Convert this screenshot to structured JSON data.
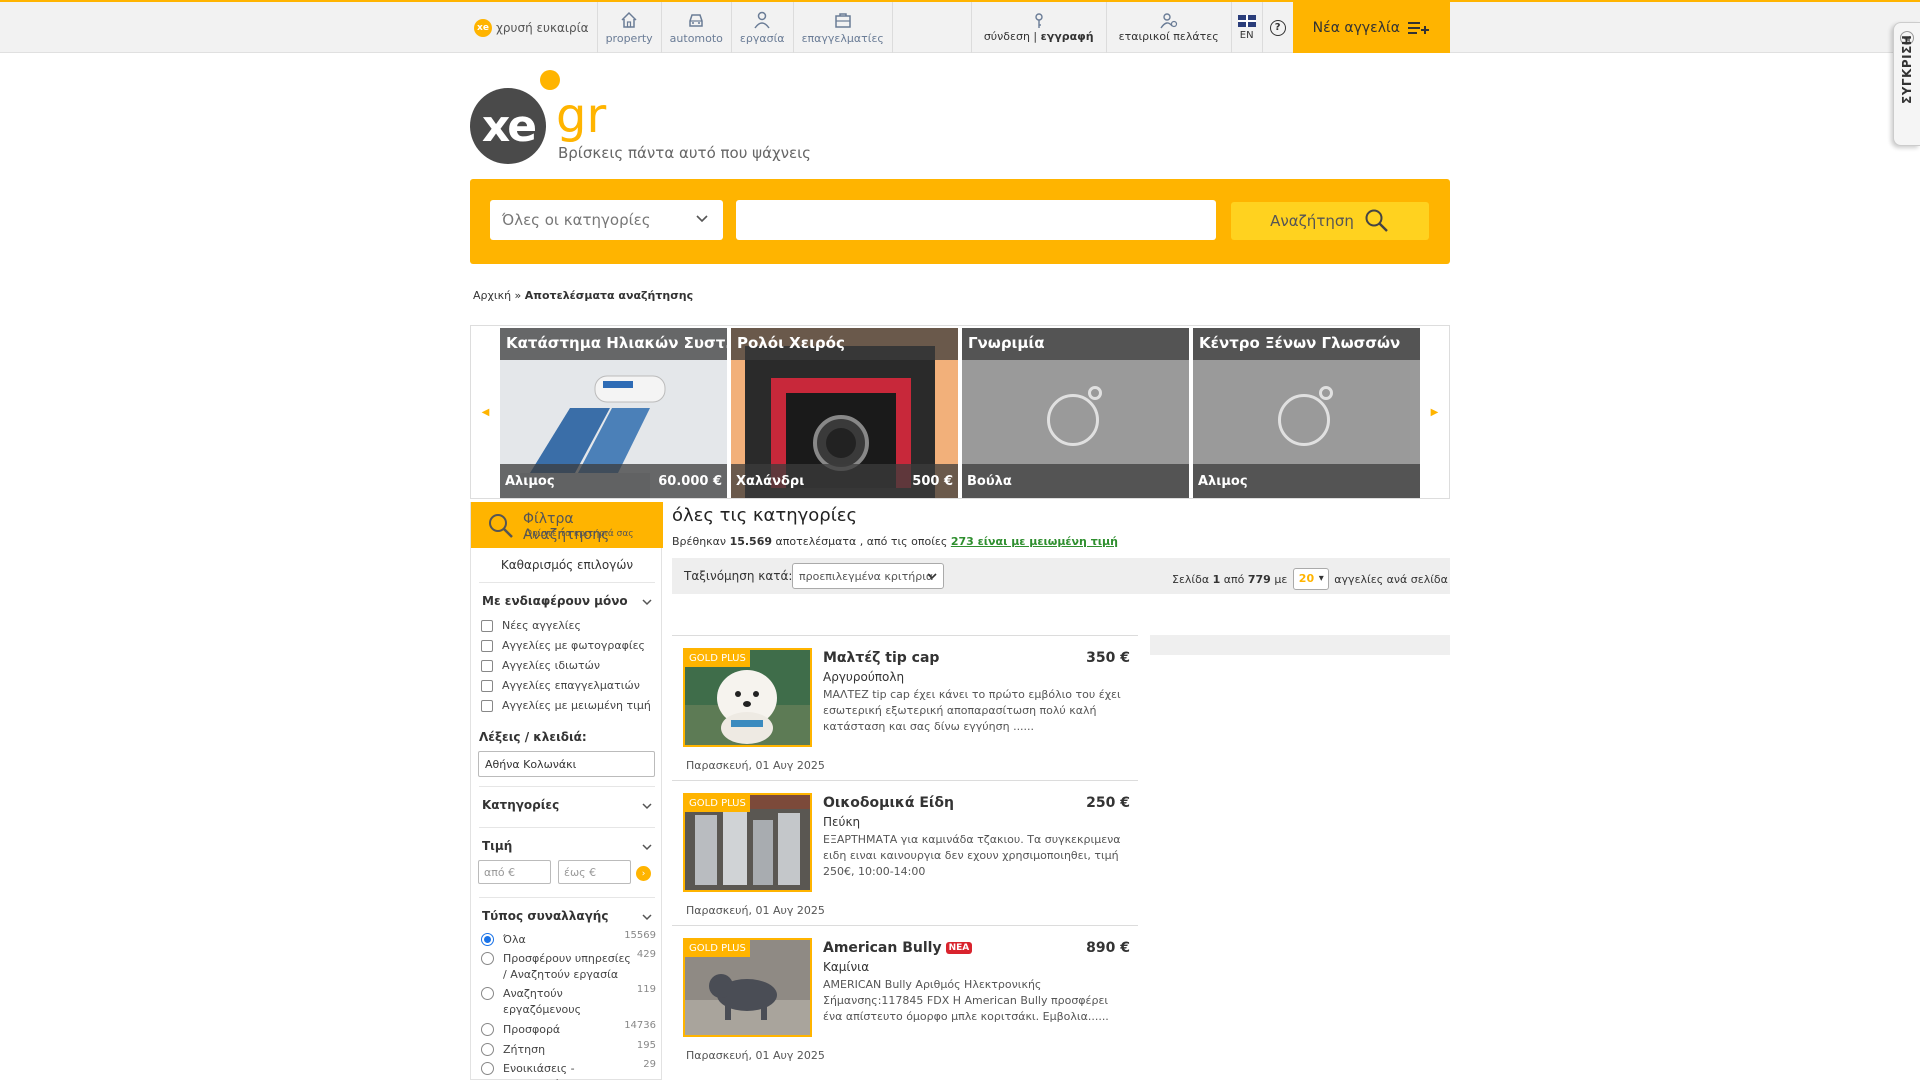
{
  "topnav": {
    "gold_logo": "xe",
    "gold_label": "χρυσή ευκαιρία",
    "items": [
      {
        "label": "property",
        "icon": "house-icon"
      },
      {
        "label": "automoto",
        "icon": "car-icon"
      },
      {
        "label": "εργασία",
        "icon": "worker-icon"
      },
      {
        "label": "επαγγελματίες",
        "icon": "briefcase-icon"
      }
    ],
    "login": "σύνδεση",
    "separator": "|",
    "register": "εγγραφή",
    "business": "εταιρικοί πελάτες",
    "lang": "EN",
    "help": "?",
    "new_ad": "Νέα αγγελία"
  },
  "compare_tab": {
    "label": "ΣΥΓΚΡΙΣΗ",
    "arrow": "◀"
  },
  "logo": {
    "circle_text": "xe",
    "domain": "gr",
    "tagline": "Βρίσκεις πάντα αυτό που ψάχνεις"
  },
  "search": {
    "category_placeholder": "Όλες οι κατηγορίες",
    "query": "",
    "button": "Αναζήτηση"
  },
  "breadcrumb": {
    "home": "Αρχική",
    "separator": "»",
    "current": "Αποτελέσματα αναζήτησης"
  },
  "carousel": {
    "left_arrow": "◀",
    "right_arrow": "▶",
    "cards": [
      {
        "title": "Κατάστημα Ηλιακών Συστ...",
        "location": "Αλιμος",
        "price": "60.000 €",
        "image": "solar-heater"
      },
      {
        "title": "Ρολόι Χειρός",
        "location": "Χαλάνδρι",
        "price": "500 €",
        "image": "wrist-watch"
      },
      {
        "title": "Γνωριμία",
        "location": "Βούλα",
        "price": "",
        "image": "placeholder"
      },
      {
        "title": "Κέντρο Ξένων Γλωσσών",
        "location": "Αλιμος",
        "price": "",
        "image": "placeholder"
      }
    ]
  },
  "filters": {
    "head_title": "Φίλτρα Αναζήτησης",
    "head_sub": "Ορίστε τα κριτήριά σας",
    "clear": "Καθαρισμός επιλογών",
    "interest_title": "Με ενδιαφέρουν μόνο",
    "interest_options": [
      "Νέες αγγελίες",
      "Αγγελίες με φωτογραφίες",
      "Αγγελίες ιδιωτών",
      "Αγγελίες επαγγελματιών",
      "Αγγελίες με μειωμένη τιμή"
    ],
    "keywords_label": "Λέξεις / κλειδιά:",
    "keywords_value": "Αθήνα Κολωνάκι",
    "categories_title": "Κατηγορίες",
    "price_title": "Τιμή",
    "price_from_placeholder": "από €",
    "price_to_placeholder": "έως €",
    "price_go": "›",
    "transaction_title": "Τύπος συναλλαγής",
    "transaction_options": [
      {
        "label": "Όλα",
        "count": "15569",
        "selected": true
      },
      {
        "label": "Προσφέρουν υπηρεσίες / Αναζητούν εργασία",
        "count": "429",
        "selected": false
      },
      {
        "label": "Αναζητούν εργαζόμενους",
        "count": "119",
        "selected": false
      },
      {
        "label": "Προσφορά",
        "count": "14736",
        "selected": false
      },
      {
        "label": "Ζήτηση",
        "count": "195",
        "selected": false
      },
      {
        "label": "Ενοικιάσεις - Προσφορά",
        "count": "29",
        "selected": false
      }
    ]
  },
  "results": {
    "title": "όλες τις κατηγορίες",
    "found_prefix": "Βρέθηκαν",
    "found_count": "15.569",
    "found_middle": "αποτελέσματα , από τις οποίες",
    "reduced_link": "273 είναι με μειωμένη τιμή",
    "sort_label": "Ταξινόμηση κατά:",
    "sort_value": "προεπιλεγμένα κριτήρια",
    "page_word": "Σελίδα",
    "page_current": "1",
    "page_of": "από",
    "page_total": "779",
    "page_with": "με",
    "per_page": "20",
    "per_page_suffix": "αγγελίες ανά σελίδα"
  },
  "listings": [
    {
      "badge": "GOLD PLUS",
      "title": "Μαλτέζ tip cap",
      "is_new": false,
      "price": "350 €",
      "location": "Αργυρούπολη",
      "description": "ΜΑΛΤΕΖ tip cap έχει κάνει το πρώτο εμβόλιο του έχει εσωτερική εξωτερική αποπαρασίτωση πολύ καλή κατάσταση και σας δίνω εγγύηση ......",
      "date": "Παρασκευή, 01 Αυγ 2025",
      "image": "puppy"
    },
    {
      "badge": "GOLD PLUS",
      "title": "Οικοδομικά Είδη",
      "is_new": false,
      "price": "250 €",
      "location": "Πεύκη",
      "description": "ΕΞΑΡΤΗΜΑΤΑ για καμινάδα τζακιου. Τα συγκεκριμενα ειδη ειναι καινουργια δεν εχουν χρησιμοποιηθει, τιμή 250€, 10:00-14:00",
      "date": "Παρασκευή, 01 Αυγ 2025",
      "image": "chimney-parts"
    },
    {
      "badge": "GOLD PLUS",
      "title": "American Bully",
      "is_new": true,
      "new_label": "ΝΕΑ",
      "price": "890 €",
      "location": "Καμίνια",
      "description": "AMERICAN Bully Αριθμός Ηλεκτρονικής Σήμανσης:117845 FDX Η American Bully προσφέρει ένα απίστευτο όμορφο μπλε κοριτσάκι. Εμβολια......",
      "date": "Παρασκευή, 01 Αυγ 2025",
      "image": "bully-dog"
    }
  ],
  "colors": {
    "brand": "#ffb400",
    "link_green": "#2f8f2f",
    "new_red": "#d9232d"
  }
}
